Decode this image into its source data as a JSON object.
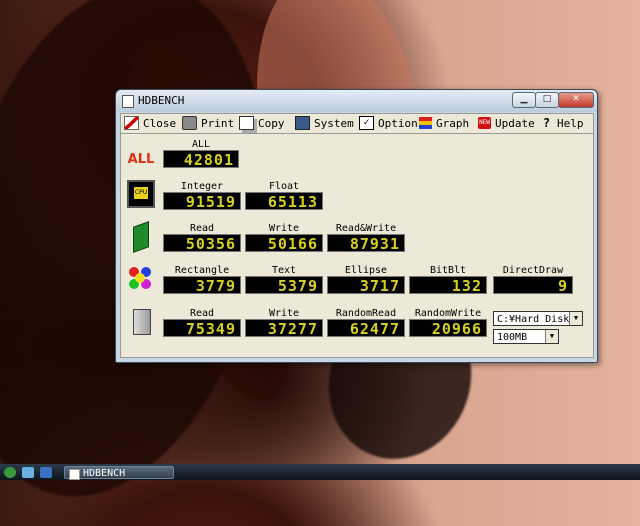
{
  "window": {
    "title": "HDBENCH"
  },
  "toolbar": [
    {
      "label": "Close",
      "icon": "close-icon"
    },
    {
      "label": "Print",
      "icon": "printer-icon"
    },
    {
      "label": "Copy",
      "icon": "copy-icon"
    },
    {
      "label": "System",
      "icon": "system-icon"
    },
    {
      "label": "Option",
      "icon": "checkbox-icon"
    },
    {
      "label": "Graph",
      "icon": "graph-icon"
    },
    {
      "label": "Update",
      "icon": "new-icon"
    },
    {
      "label": "Help",
      "icon": "help-icon"
    }
  ],
  "all": {
    "badge": "ALL",
    "label": "ALL",
    "value": "42801"
  },
  "cpu": {
    "icon_text": "CPU",
    "integer": {
      "label": "Integer",
      "value": "91519"
    },
    "float": {
      "label": "Float",
      "value": "65113"
    }
  },
  "memory": {
    "read": {
      "label": "Read",
      "value": "50356"
    },
    "write": {
      "label": "Write",
      "value": "50166"
    },
    "readwrite": {
      "label": "Read&Write",
      "value": "87931"
    }
  },
  "video": {
    "rectangle": {
      "label": "Rectangle",
      "value": "3779"
    },
    "text": {
      "label": "Text",
      "value": "5379"
    },
    "ellipse": {
      "label": "Ellipse",
      "value": "3717"
    },
    "bitblt": {
      "label": "BitBlt",
      "value": "132"
    },
    "directdraw": {
      "label": "DirectDraw",
      "value": "9"
    }
  },
  "disk": {
    "read": {
      "label": "Read",
      "value": "75349"
    },
    "write": {
      "label": "Write",
      "value": "37277"
    },
    "randomread": {
      "label": "RandomRead",
      "value": "62477"
    },
    "randomwrite": {
      "label": "RandomWrite",
      "value": "20966"
    },
    "drive_select": "C:¥Hard Disk",
    "size_select": "100MB"
  },
  "taskbar": {
    "window_button": "HDBENCH"
  },
  "colors": {
    "lcd_text": "#d8d020",
    "all_badge": "#e03010"
  }
}
